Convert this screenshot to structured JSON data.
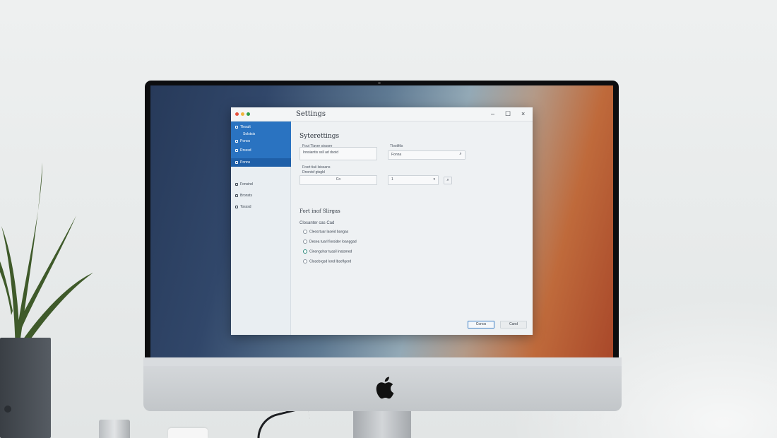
{
  "window": {
    "title": "Settings",
    "controls": {
      "minimize": "–",
      "maximize": "☐",
      "close": "×"
    },
    "traffic_lights": [
      "#e5503b",
      "#f0b43c",
      "#2f9e49"
    ]
  },
  "sidebar": {
    "items": [
      {
        "label": "Tlnsult"
      },
      {
        "label": "Solstsis"
      },
      {
        "label": "Ponos"
      },
      {
        "label": "Rrsssd"
      },
      {
        "label": "Ponns"
      },
      {
        "label": "Fonsind"
      },
      {
        "label": "Bronsts"
      },
      {
        "label": "Tosssd"
      }
    ]
  },
  "main": {
    "section_title": "Syterettings",
    "fields": {
      "field1_label": "Fout Tlaver sispsre",
      "field1_value": "Innsiantis ssll ad dsoid",
      "field2_label": "Tlostfitls",
      "field2_value": "Fonna",
      "field2_button": "⌕",
      "field3_label": "Fosrt tiuii lsissans",
      "field3_sublabel": "Dnontsf gtsgbl",
      "field3_value": "Co",
      "dropdown_value": "1",
      "dropdown_arrow": "▾",
      "dropdown_button": "⌕"
    },
    "subsection_title": "Fort inof Slirgas",
    "options_label": "Closanter cas Cad",
    "options": [
      {
        "label": "Cleosrtuar laseid bangas",
        "selected": false
      },
      {
        "label": "Desea tuarl fiorsider loanggad",
        "selected": false
      },
      {
        "label": "Cinongchar tuasil lnatsmed",
        "selected": true
      },
      {
        "label": "Closebrgsd lond lbseflgerd",
        "selected": false
      }
    ]
  },
  "buttons": {
    "primary": "Conos",
    "secondary": "Cand"
  },
  "colors": {
    "accent": "#2a73c1",
    "radio_selected": "#2c8a7c"
  }
}
